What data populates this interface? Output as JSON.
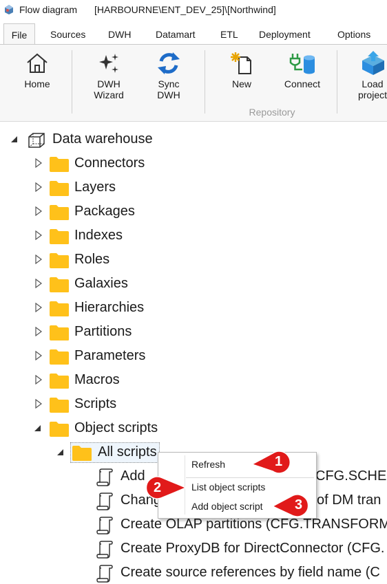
{
  "window": {
    "app_title": "Flow diagram",
    "connection_title": "[HARBOURNE\\ENT_DEV_25]\\[Northwind]"
  },
  "ribbon_tabs": [
    "File",
    "Sources",
    "DWH",
    "Datamart",
    "ETL",
    "Deployment",
    "Options"
  ],
  "ribbon": {
    "buttons": [
      {
        "label": "Home",
        "icon": "home-icon"
      },
      {
        "label": "DWH\nWizard",
        "icon": "sparkle-wizard-icon"
      },
      {
        "label": "Sync\nDWH",
        "icon": "sync-icon"
      },
      {
        "label": "New",
        "icon": "new-document-icon"
      },
      {
        "label": "Connect",
        "icon": "plug-database-icon"
      },
      {
        "label": "Load\nproject",
        "icon": "load-project-icon"
      }
    ],
    "group_label": "Repository"
  },
  "tree": {
    "root": {
      "label": "Data warehouse",
      "icon": "cube-icon"
    },
    "folders": [
      "Connectors",
      "Layers",
      "Packages",
      "Indexes",
      "Roles",
      "Galaxies",
      "Hierarchies",
      "Partitions",
      "Parameters",
      "Macros",
      "Scripts",
      "Object scripts"
    ],
    "subfolder": "All scripts",
    "scripts": [
      "Add",
      "Chang",
      "Create OLAP partitions (CFG.TRANSFORM",
      "Create ProxyDB for DirectConnector (CFG.",
      "Create source references by field name (C"
    ],
    "script_tails": [
      "CFG.SCHEM",
      "of DM tran"
    ]
  },
  "context_menu": {
    "items": [
      "Refresh",
      "List object scripts",
      "Add object script"
    ]
  },
  "callouts": [
    "1",
    "2",
    "3"
  ],
  "colors": {
    "folder": "#ffc11a",
    "callout": "#e11a1a",
    "sync_blue": "#1e6cc8",
    "connect_green": "#2e9a46"
  }
}
